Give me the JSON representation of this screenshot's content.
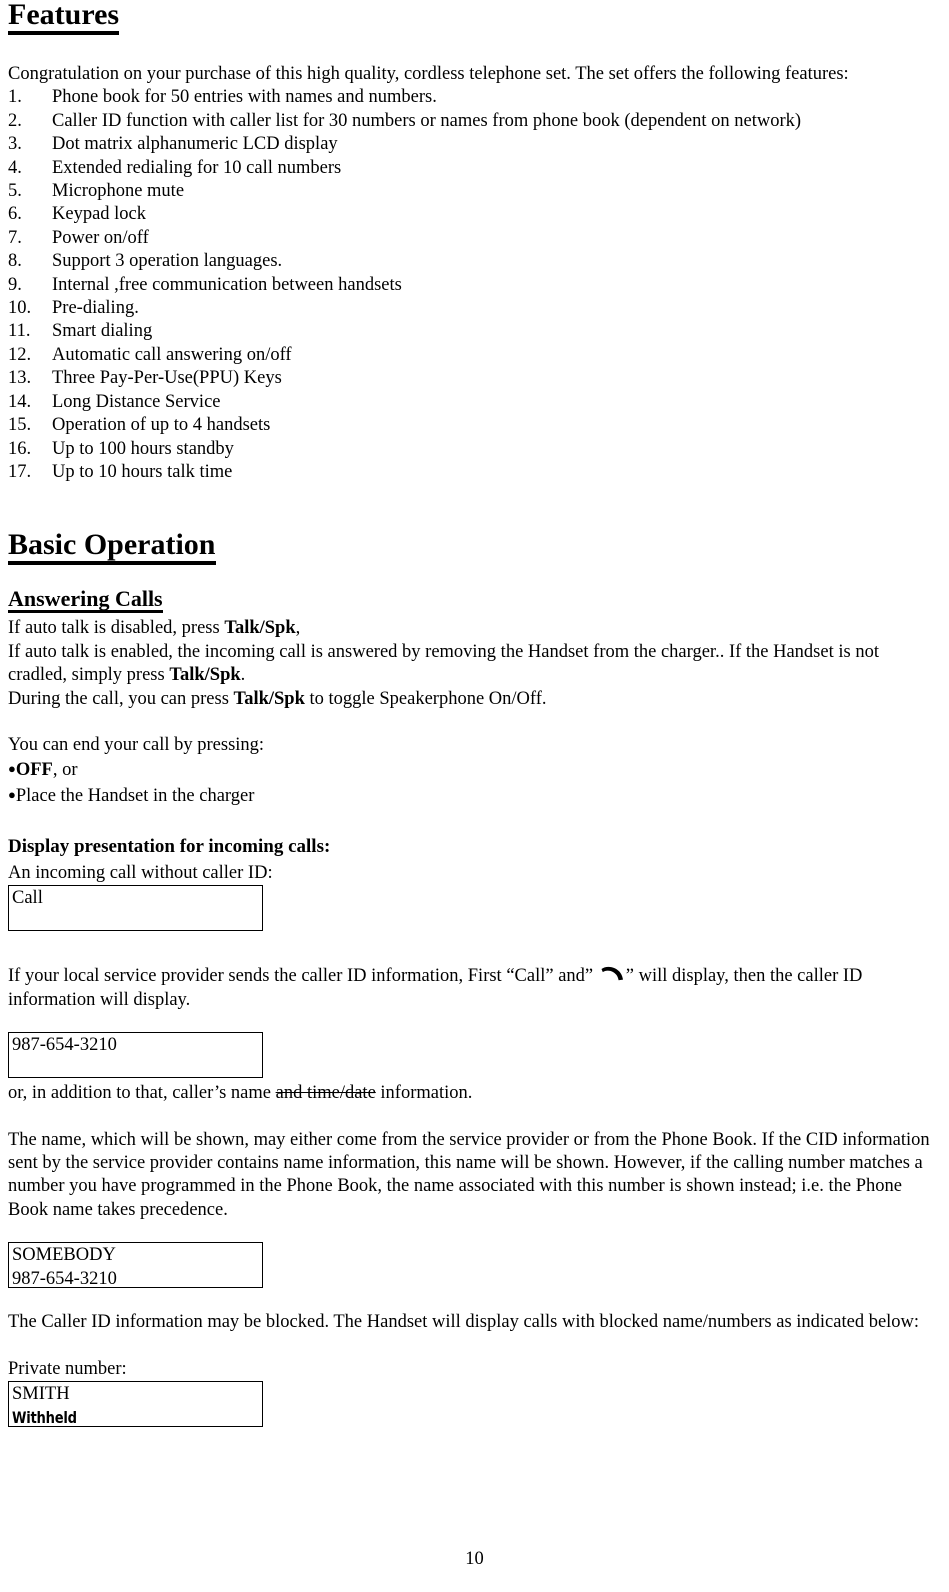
{
  "document": {
    "page_number": "10"
  },
  "features_section": {
    "heading": "Features",
    "intro": "Congratulation on your purchase of this high quality, cordless telephone set. The set offers the following features:",
    "items": [
      {
        "num": "1.",
        "text": "Phone book for 50 entries with names and numbers."
      },
      {
        "num": "2.",
        "text": "Caller ID function with caller list for 30 numbers or names from phone book (dependent on network)"
      },
      {
        "num": "3.",
        "text": "Dot matrix alphanumeric  LCD display"
      },
      {
        "num": "4.",
        "text": "Extended redialing for 10 call numbers"
      },
      {
        "num": "5.",
        "text": "Microphone mute"
      },
      {
        "num": "6.",
        "text": "Keypad lock"
      },
      {
        "num": "7.",
        "text": "Power on/off"
      },
      {
        "num": "8.",
        "text": "Support 3 operation languages."
      },
      {
        "num": "9.",
        "text": "Internal ,free communication between handsets"
      },
      {
        "num": "10.",
        "text": "Pre-dialing."
      },
      {
        "num": "11.",
        "text": "Smart dialing"
      },
      {
        "num": "12.",
        "text": "Automatic call answering on/off"
      },
      {
        "num": "13.",
        "text": "Three Pay-Per-Use(PPU) Keys"
      },
      {
        "num": "14.",
        "text": "Long Distance Service"
      },
      {
        "num": "15.",
        "text": "Operation of up to 4 handsets"
      },
      {
        "num": "16.",
        "text": "Up to 100 hours standby"
      },
      {
        "num": "17.",
        "text": "Up to 10 hours talk time"
      }
    ]
  },
  "basic_operation": {
    "heading": "Basic Operation",
    "answering_calls": {
      "heading": "Answering Calls",
      "line1_pre": "If auto talk is disabled, press ",
      "line1_bold": "Talk/Spk",
      "line1_post": ",",
      "line2": "If auto talk is enabled, the incoming call is answered by removing the Handset from the charger.. If the Handset is not cradled, simply press ",
      "line2_bold": "Talk/Spk",
      "line2_post": ".",
      "line3_pre": "During the call, you can press ",
      "line3_bold": "Talk/Spk",
      "line3_post": " to toggle Speakerphone On/Off.",
      "end_call_intro": "You can end your call by pressing:",
      "end_call_bullets": [
        {
          "bullet": "●",
          "bold": "OFF",
          "rest": ", or"
        },
        {
          "bullet": "●",
          "bold": "",
          "rest": "Place the Handset in the charger"
        }
      ]
    },
    "display_presentation": {
      "heading": "Display presentation for incoming calls:",
      "no_caller_id_label": "An incoming call without caller ID:",
      "lcd_call": {
        "line1": "Call",
        "line2": ""
      },
      "caller_id_para_pre": "If your local service provider sends the caller ID information, First “Call” and” ",
      "caller_id_icon": "handset-icon",
      "caller_id_para_post": "” will display, then the caller ID information will display.",
      "lcd_number": {
        "line1": "987-654-3210",
        "line2": ""
      },
      "name_note_pre": "or, in addition to that, caller’s name ",
      "name_note_strike": "and time/date",
      "name_note_post": " information.",
      "name_source_para": "The name, which will be shown, may either come from the service provider or from the Phone Book.  If the CID information sent by the service provider contains name information, this name will be shown.  However, if the calling number matches a number you have programmed in the Phone Book, the name associated with this number is shown instead; i.e. the Phone Book name takes precedence.",
      "lcd_name_number": {
        "line1": "SOMEBODY",
        "line2": "987-654-3210"
      },
      "blocked_para": "The Caller ID information may be blocked. The Handset will display calls with blocked name/numbers as indicated below:",
      "private_number_label": "Private number:",
      "lcd_private": {
        "line1": "SMITH",
        "line2": "Withheld"
      }
    }
  }
}
